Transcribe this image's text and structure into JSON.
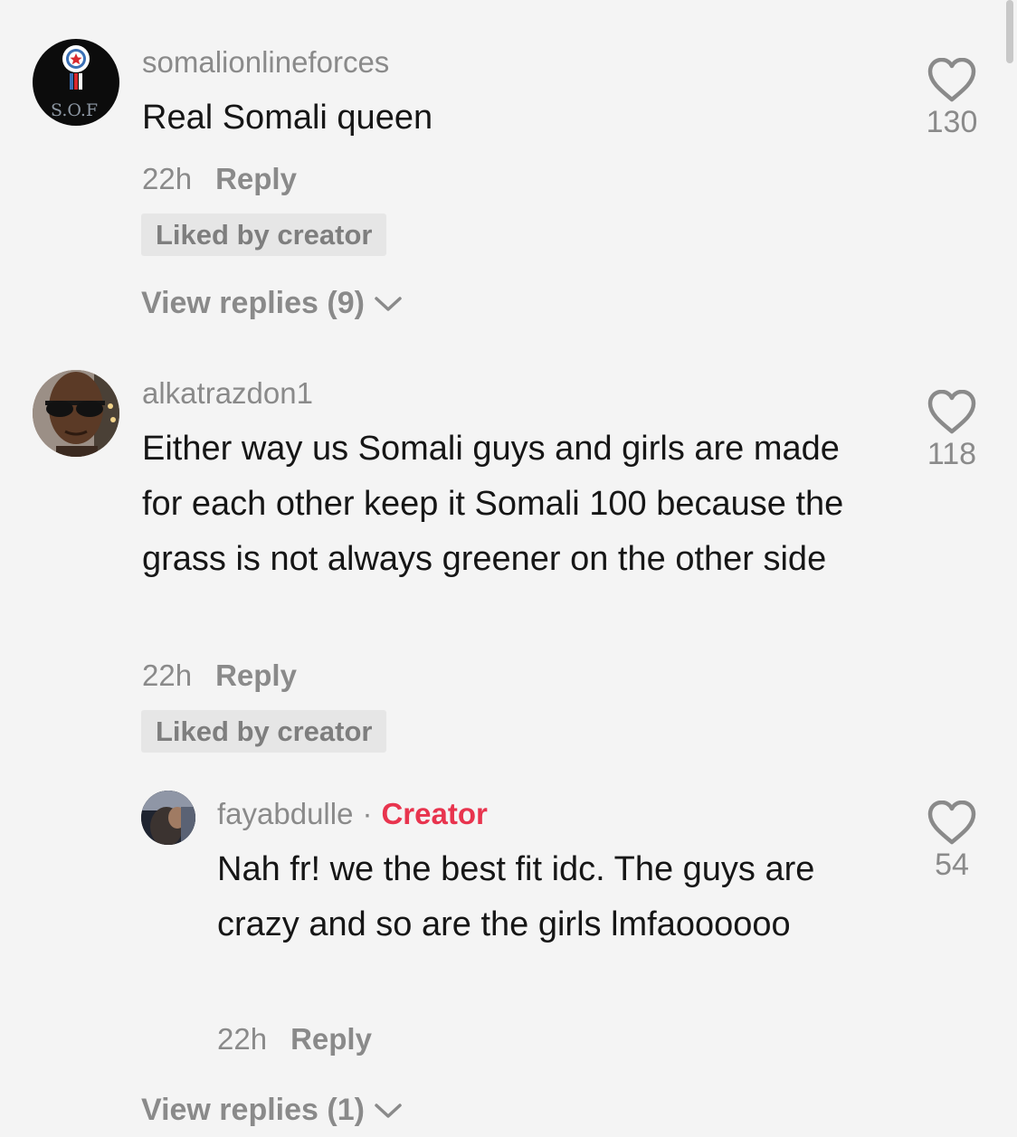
{
  "comments": [
    {
      "username": "somalionlineforces",
      "avatar_text": "S.O.F",
      "text": "Real Somali queen",
      "time": "22h",
      "reply_label": "Reply",
      "liked_badge": "Liked by creator",
      "likes": "130",
      "view_replies": "View replies (9)"
    },
    {
      "username": "alkatrazdon1",
      "text": "Either way us Somali guys and girls are made for each other keep it Somali 100 because the grass is not always greener on the other side",
      "time": "22h",
      "reply_label": "Reply",
      "liked_badge": "Liked by creator",
      "likes": "118"
    }
  ],
  "reply": {
    "username": "fayabdulle",
    "separator": "·",
    "creator_label": "Creator",
    "text": "Nah fr! we the best fit idc. The guys are crazy and so are the girls lmfaoooooo",
    "time": "22h",
    "reply_label": "Reply",
    "likes": "54",
    "view_replies": "View replies (1)"
  },
  "colors": {
    "background": "#f4f4f4",
    "text": "#161616",
    "muted": "#8a8a8a",
    "creator_accent": "#e8344e",
    "badge_bg": "#e6e6e6"
  },
  "icons": [
    "heart-outline-icon",
    "chevron-down-icon",
    "medal-icon"
  ]
}
